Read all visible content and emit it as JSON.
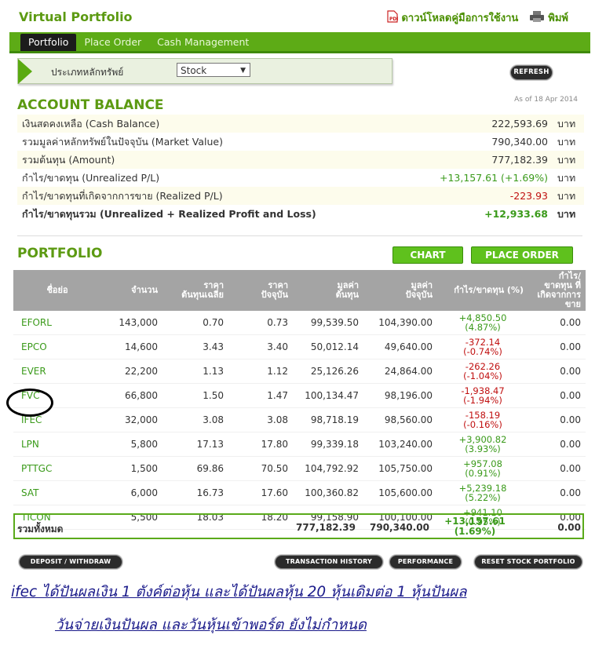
{
  "header": {
    "title": "Virtual Portfolio",
    "download_label": "ดาวน์โหลดคู่มือการใช้งาน",
    "print_label": "พิมพ์"
  },
  "nav": {
    "tabs": [
      "Portfolio",
      "Place Order",
      "Cash Management"
    ]
  },
  "filter": {
    "label": "ประเภทหลักทรัพย์",
    "value": "Stock",
    "refresh": "REFRESH"
  },
  "balance": {
    "title": "ACCOUNT BALANCE",
    "as_of": "As of 18 Apr 2014",
    "rows": [
      {
        "label": "เงินสดคงเหลือ (Cash Balance)",
        "value": "222,593.69",
        "unit": "บาท"
      },
      {
        "label": "รวมมูลค่าหลักทรัพย์ในปัจจุบัน (Market Value)",
        "value": "790,340.00",
        "unit": "บาท"
      },
      {
        "label": "รวมต้นทุน (Amount)",
        "value": "777,182.39",
        "unit": "บาท"
      },
      {
        "label": "กำไร/ขาดทุน (Unrealized P/L)",
        "value": "+13,157.61 (+1.69%)",
        "unit": "บาท"
      },
      {
        "label": "กำไร/ขาดทุนที่เกิดจากการขาย (Realized P/L)",
        "value": "-223.93",
        "unit": "บาท"
      },
      {
        "label": "กำไร/ขาดทุนรวม (Unrealized + Realized Profit and Loss)",
        "value": "+12,933.68",
        "unit": "บาท"
      }
    ]
  },
  "portfolio": {
    "title": "PORTFOLIO",
    "chart_btn": "CHART",
    "order_btn": "PLACE ORDER",
    "headers": [
      [
        "ชื่อย่อ"
      ],
      [
        "จำนวน"
      ],
      [
        "ราคา",
        "ต้นทุนเฉลี่ย"
      ],
      [
        "ราคา",
        "ปัจจุบัน"
      ],
      [
        "มูลค่า",
        "ต้นทุน"
      ],
      [
        "มูลค่า",
        "ปัจจุบัน"
      ],
      [
        "กำไร/ขาดทุน (%)"
      ],
      [
        "กำไร/ขาดทุน ที่",
        "เกิดจากการขาย"
      ]
    ],
    "rows": [
      {
        "sym": "EFORL",
        "qty": "143,000",
        "avg": "0.70",
        "cur": "0.73",
        "cost": "99,539.50",
        "mkt": "104,390.00",
        "pl": "+4,850.50",
        "pct": "(4.87%)",
        "rpl": "0.00"
      },
      {
        "sym": "EPCO",
        "qty": "14,600",
        "avg": "3.43",
        "cur": "3.40",
        "cost": "50,012.14",
        "mkt": "49,640.00",
        "pl": "-372.14",
        "pct": "(-0.74%)",
        "rpl": "0.00"
      },
      {
        "sym": "EVER",
        "qty": "22,200",
        "avg": "1.13",
        "cur": "1.12",
        "cost": "25,126.26",
        "mkt": "24,864.00",
        "pl": "-262.26",
        "pct": "(-1.04%)",
        "rpl": "0.00"
      },
      {
        "sym": "FVC",
        "qty": "66,800",
        "avg": "1.50",
        "cur": "1.47",
        "cost": "100,134.47",
        "mkt": "98,196.00",
        "pl": "-1,938.47",
        "pct": "(-1.94%)",
        "rpl": "0.00"
      },
      {
        "sym": "IFEC",
        "qty": "32,000",
        "avg": "3.08",
        "cur": "3.08",
        "cost": "98,718.19",
        "mkt": "98,560.00",
        "pl": "-158.19",
        "pct": "(-0.16%)",
        "rpl": "0.00"
      },
      {
        "sym": "LPN",
        "qty": "5,800",
        "avg": "17.13",
        "cur": "17.80",
        "cost": "99,339.18",
        "mkt": "103,240.00",
        "pl": "+3,900.82",
        "pct": "(3.93%)",
        "rpl": "0.00"
      },
      {
        "sym": "PTTGC",
        "qty": "1,500",
        "avg": "69.86",
        "cur": "70.50",
        "cost": "104,792.92",
        "mkt": "105,750.00",
        "pl": "+957.08",
        "pct": "(0.91%)",
        "rpl": "0.00"
      },
      {
        "sym": "SAT",
        "qty": "6,000",
        "avg": "16.73",
        "cur": "17.60",
        "cost": "100,360.82",
        "mkt": "105,600.00",
        "pl": "+5,239.18",
        "pct": "(5.22%)",
        "rpl": "0.00"
      },
      {
        "sym": "TICON",
        "qty": "5,500",
        "avg": "18.03",
        "cur": "18.20",
        "cost": "99,158.90",
        "mkt": "100,100.00",
        "pl": "+941.10",
        "pct": "(0.95%)",
        "rpl": "0.00"
      }
    ],
    "total": {
      "label": "รวมทั้งหมด",
      "cost": "777,182.39",
      "mkt": "790,340.00",
      "pl": "+13,157.61",
      "pct": "(1.69%)",
      "rpl": "0.00"
    }
  },
  "buttons": {
    "deposit": "DEPOSIT / WITHDRAW",
    "history": "TRANSACTION HISTORY",
    "performance": "PERFORMANCE",
    "reset": "RESET STOCK PORTFOLIO"
  },
  "note": {
    "line1": "ifec ได้ปันผลเงิน 1 ตังค์ต่อหุ้น และได้ปันผลหุ้น 20 หุ้นเดิมต่อ 1 หุ้นปันผล",
    "line2": "วันจ่ายเงินปันผล และวันหุ้นเข้าพอร์ต ยังไม่กำหนด"
  },
  "colors": {
    "green": "#5c9a12",
    "pos": "#3a9a1a",
    "neg": "#c01010",
    "header_gray": "#a4a4a4"
  }
}
